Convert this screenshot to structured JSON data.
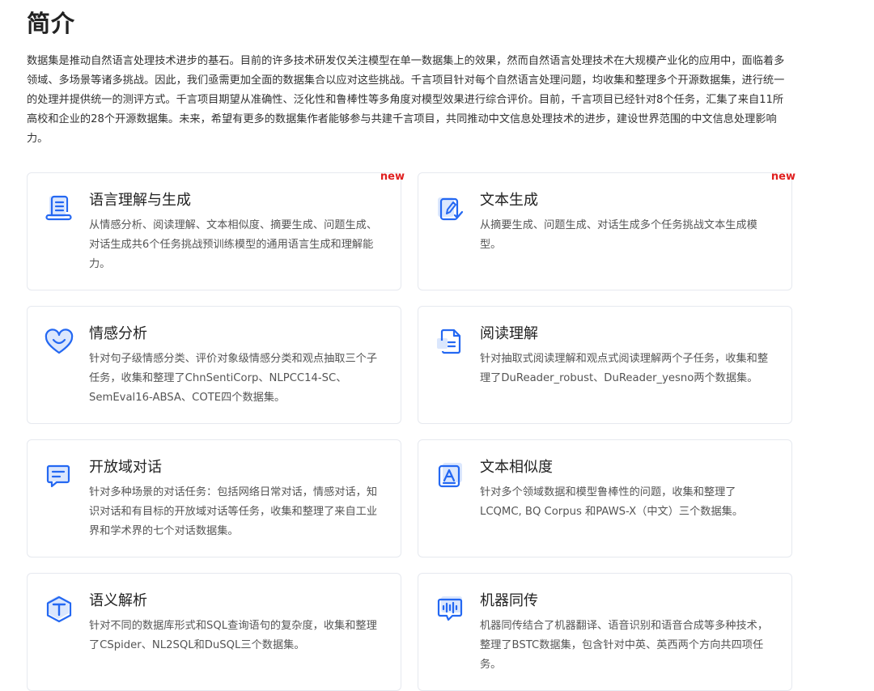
{
  "page": {
    "title": "简介",
    "intro": "数据集是推动自然语言处理技术进步的基石。目前的许多技术研发仅关注模型在单一数据集上的效果，然而自然语言处理技术在大规模产业化的应用中，面临着多领域、多场景等诸多挑战。因此，我们亟需更加全面的数据集合以应对这些挑战。千言项目针对每个自然语言处理问题，均收集和整理多个开源数据集，进行统一的处理并提供统一的测评方式。千言项目期望从准确性、泛化性和鲁棒性等多角度对模型效果进行综合评价。目前，千言项目已经针对8个任务，汇集了来自11所高校和企业的28个开源数据集。未来，希望有更多的数据集作者能够参与共建千言项目，共同推动中文信息处理技术的进步，建设世界范围的中文信息处理影响力。"
  },
  "accent_color": "#2468f2",
  "badge_color": "#e02020",
  "cards": [
    {
      "title": "语言理解与生成",
      "desc": "从情感分析、阅读理解、文本相似度、摘要生成、问题生成、对话生成共6个任务挑战预训练模型的通用语言生成和理解能力。",
      "badge": "new",
      "icon": "document-list-icon"
    },
    {
      "title": "文本生成",
      "desc": "从摘要生成、问题生成、对话生成多个任务挑战文本生成模型。",
      "badge": "new",
      "icon": "pen-edit-icon"
    },
    {
      "title": "情感分析",
      "desc": "针对句子级情感分类、评价对象级情感分类和观点抽取三个子任务，收集和整理了ChnSentiCorp、NLPCC14-SC、SemEval16-ABSA、COTE四个数据集。",
      "badge": "",
      "icon": "smile-heart-icon"
    },
    {
      "title": "阅读理解",
      "desc": "针对抽取式阅读理解和观点式阅读理解两个子任务，收集和整理了DuReader_robust、DuReader_yesno两个数据集。",
      "badge": "",
      "icon": "reading-doc-icon"
    },
    {
      "title": "开放域对话",
      "desc": "针对多种场景的对话任务：包括网络日常对话，情感对话，知识对话和有目标的开放域对话等任务，收集和整理了来自工业界和学术界的七个对话数据集。",
      "badge": "",
      "icon": "chat-bubble-icon"
    },
    {
      "title": "文本相似度",
      "desc": "针对多个领域数据和模型鲁棒性的问题，收集和整理了LCQMC, BQ Corpus 和PAWS-X（中文）三个数据集。",
      "badge": "",
      "icon": "letter-a-icon"
    },
    {
      "title": "语义解析",
      "desc": "针对不同的数据库形式和SQL查询语句的复杂度，收集和整理了CSpider、NL2SQL和DuSQL三个数据集。",
      "badge": "",
      "icon": "letter-t-icon"
    },
    {
      "title": "机器同传",
      "desc": "机器同传结合了机器翻译、语音识别和语音合成等多种技术，整理了BSTC数据集，包含针对中英、英西两个方向共四项任务。",
      "badge": "",
      "icon": "audio-wave-icon"
    }
  ]
}
